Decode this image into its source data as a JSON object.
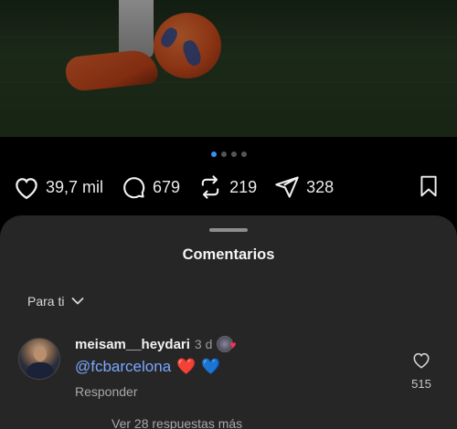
{
  "post": {
    "carousel": {
      "count": 4,
      "active_index": 0
    },
    "actions": {
      "like_count": "39,7 mil",
      "comment_count": "679",
      "repost_count": "219",
      "share_count": "328"
    }
  },
  "comments_sheet": {
    "title": "Comentarios",
    "filter_label": "Para ti",
    "comments": [
      {
        "username": "meisam__heydari",
        "time": "3 d",
        "mention": "@fcbarcelona",
        "emojis": [
          "❤️",
          "💙"
        ],
        "reply_label": "Responder",
        "like_count": "515"
      }
    ],
    "more_replies_label": "Ver 28 respuestas más"
  },
  "colors": {
    "background": "#000000",
    "sheet": "#262626",
    "accent_blue": "#3d8bff",
    "mention": "#7aa7ff",
    "heart_red": "#ff2d55",
    "heart_blue": "#2f6fd6"
  },
  "icons": {
    "like": "heart-icon",
    "comment": "comment-bubble-icon",
    "repost": "repost-icon",
    "share": "send-icon",
    "save": "bookmark-icon",
    "filter": "chevron-down-icon",
    "comment_like": "heart-icon"
  }
}
